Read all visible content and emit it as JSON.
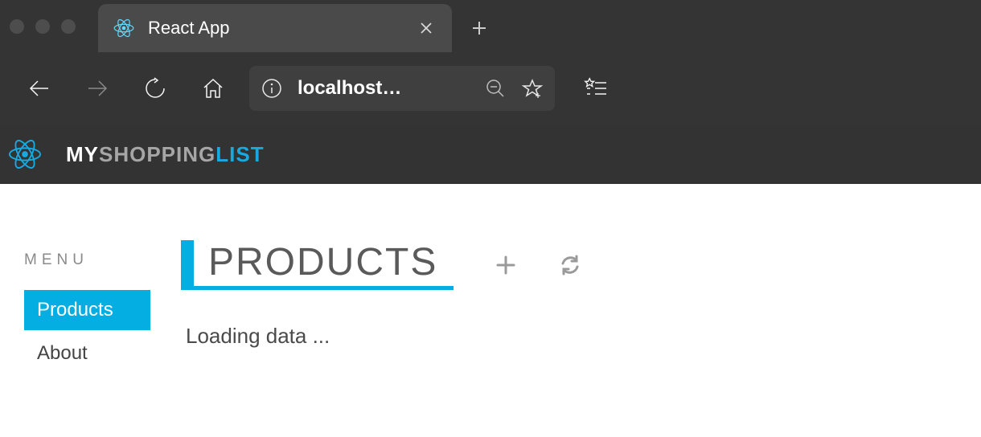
{
  "browser": {
    "tab_title": "React App",
    "url_display": "localhost…"
  },
  "app": {
    "title_my": "MY",
    "title_shopping": "SHOPPING",
    "title_list": "LIST"
  },
  "sidebar": {
    "heading": "MENU",
    "items": [
      {
        "label": "Products",
        "active": true
      },
      {
        "label": "About",
        "active": false
      }
    ]
  },
  "main": {
    "heading": "PRODUCTS",
    "status": "Loading data ..."
  },
  "colors": {
    "accent": "#04aee2",
    "chrome_bg": "#343434"
  }
}
